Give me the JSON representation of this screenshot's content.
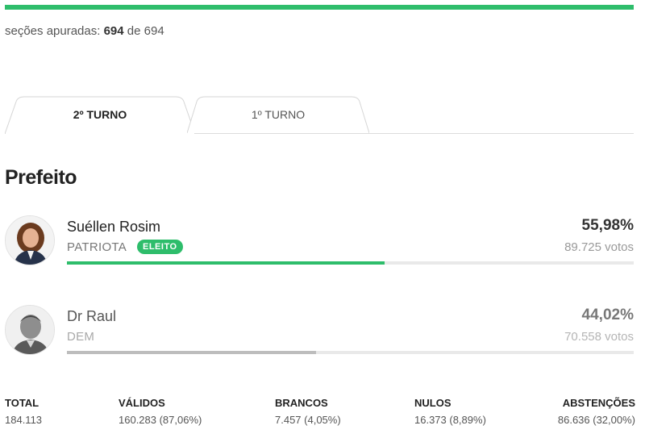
{
  "progress": {
    "apuradas": 694,
    "total": 694,
    "percent": 100,
    "color": "#2ebd6b"
  },
  "sections": {
    "prefix": "seções apuradas:",
    "count": "694",
    "connector": "de",
    "total": "694"
  },
  "tabs": [
    {
      "label": "2º TURNO",
      "active": true
    },
    {
      "label": "1º TURNO",
      "active": false
    }
  ],
  "office": {
    "title": "Prefeito"
  },
  "candidates": [
    {
      "name": "Suéllen Rosim",
      "party": "PATRIOTA",
      "badge": "ELEITO",
      "percent": "55,98%",
      "percent_value": 55.98,
      "votes": "89.725 votos",
      "bar_color": "#2ebd6b"
    },
    {
      "name": "Dr Raul",
      "party": "DEM",
      "badge": "",
      "percent": "44,02%",
      "percent_value": 44.02,
      "votes": "70.558 votos",
      "bar_color": "#bdbdbd"
    }
  ],
  "stats": [
    {
      "label": "TOTAL",
      "value": "184.113"
    },
    {
      "label": "VÁLIDOS",
      "value": "160.283 (87,06%)"
    },
    {
      "label": "BRANCOS",
      "value": "7.457 (4,05%)"
    },
    {
      "label": "NULOS",
      "value": "16.373 (8,89%)"
    },
    {
      "label": "ABSTENÇÕES",
      "value": "86.636 (32,00%)"
    }
  ]
}
